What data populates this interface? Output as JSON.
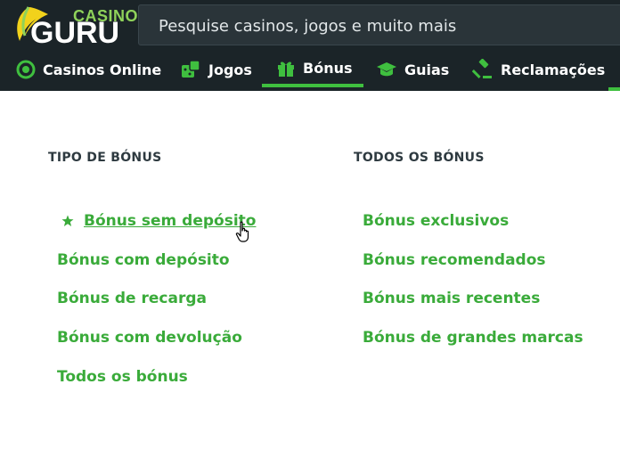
{
  "header": {
    "logo_small": "CASINO",
    "logo_big": "GURU",
    "search_placeholder": "Pesquise casinos, jogos e muito mais"
  },
  "nav": {
    "items": [
      {
        "label": "Casinos Online",
        "icon": "chip-icon"
      },
      {
        "label": "Jogos",
        "icon": "dice-icon"
      },
      {
        "label": "Bónus",
        "icon": "gift-icon",
        "active": true
      },
      {
        "label": "Guias",
        "icon": "graduation-cap-icon"
      },
      {
        "label": "Reclamações",
        "icon": "gavel-icon"
      }
    ]
  },
  "menu": {
    "left_heading": "TIPO DE BÓNUS",
    "right_heading": "TODOS OS BÓNUS",
    "left_links": [
      "Bónus sem depósito",
      "Bónus com depósito",
      "Bónus de recarga",
      "Bónus com devolução",
      "Todos os bónus"
    ],
    "right_links": [
      "Bónus exclusivos",
      "Bónus recomendados",
      "Bónus mais recentes",
      "Bónus de grandes marcas"
    ]
  },
  "colors": {
    "header_bg": "#1b2428",
    "accent_green": "#3fbf3f",
    "link_green": "#3aab3a"
  }
}
